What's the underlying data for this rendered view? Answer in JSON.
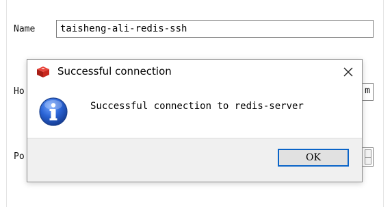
{
  "form": {
    "name_label": "Name",
    "name_value": "taisheng-ali-redis-ssh",
    "host_label_partial": "Ho",
    "host_value_partial": "m",
    "port_label_partial": "Po"
  },
  "dialog": {
    "title": "Successful connection",
    "message": "Successful connection to redis-server",
    "ok_label": "OK",
    "close_glyph": "✕",
    "app_icon": "redis-cube-icon",
    "message_icon": "info-icon"
  },
  "colors": {
    "redis_red": "#c8281e",
    "info_blue": "#1f5ec8",
    "ok_focus_border": "#0a64c8",
    "footer_bg": "#f0f0f0"
  }
}
